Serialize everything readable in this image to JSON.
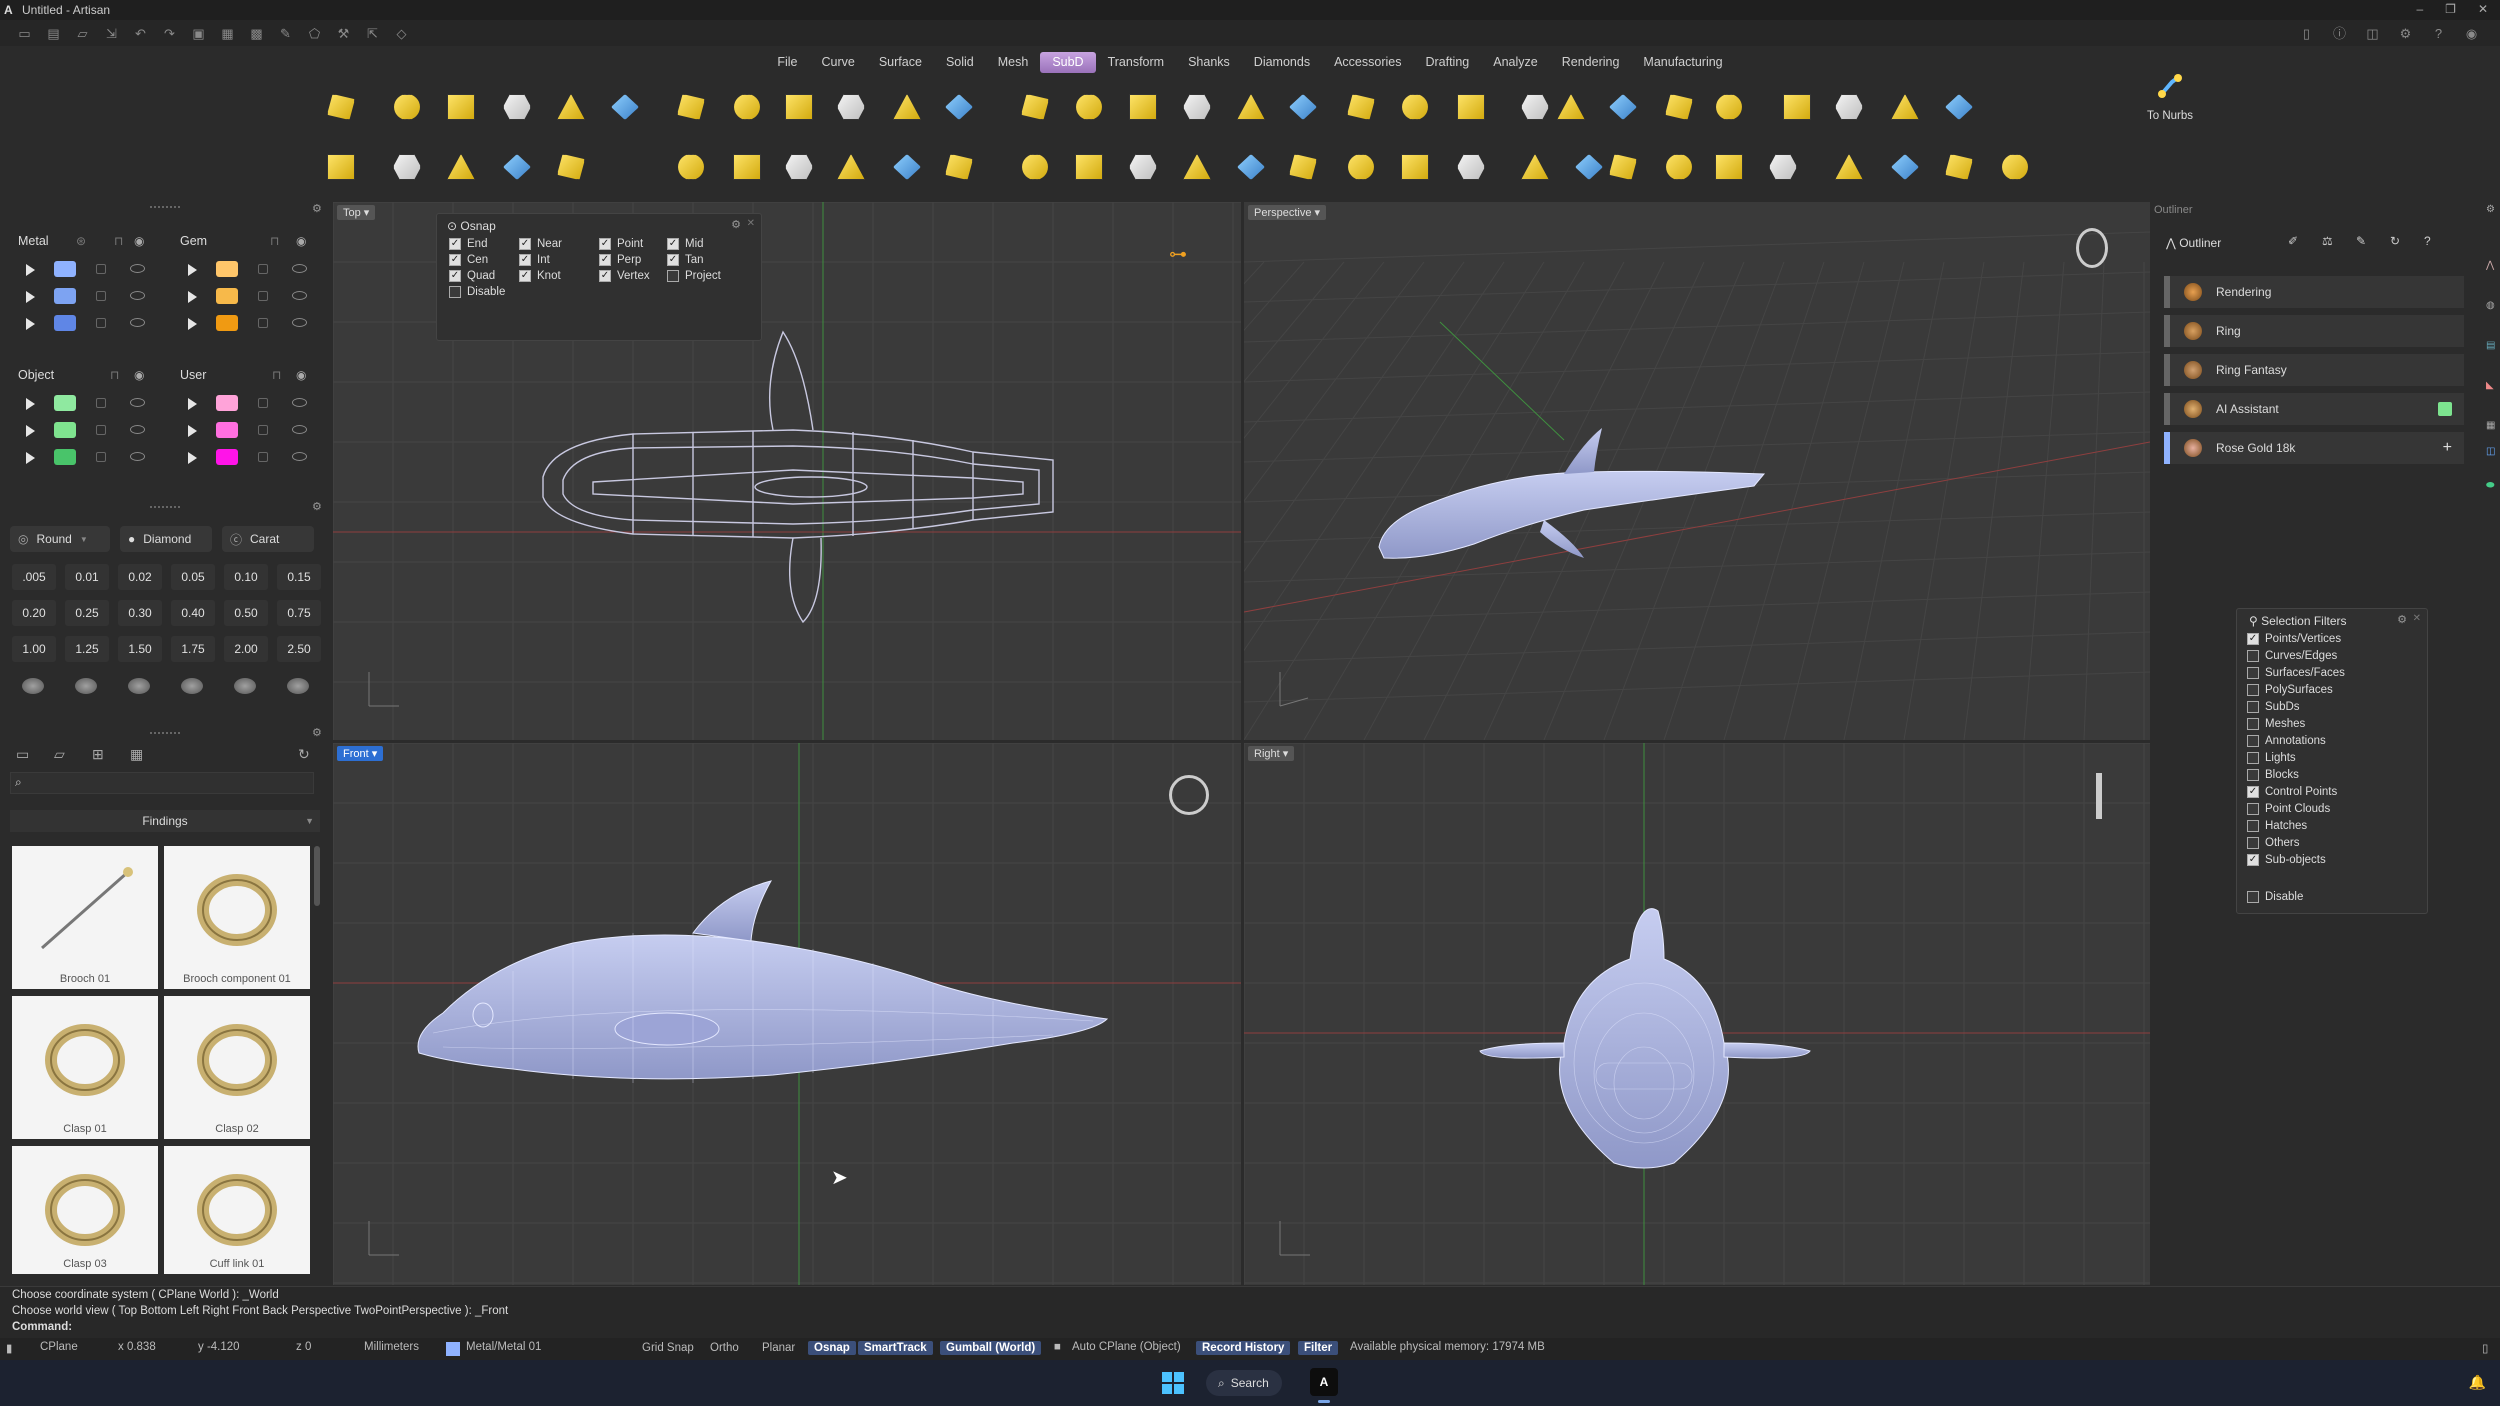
{
  "window": {
    "title": "Untitled - Artisan",
    "logo": "A"
  },
  "menu": [
    "File",
    "Curve",
    "Surface",
    "Solid",
    "Mesh",
    "SubD",
    "Transform",
    "Shanks",
    "Diamonds",
    "Accessories",
    "Drafting",
    "Analyze",
    "Rendering",
    "Manufacturing"
  ],
  "menu_active": "SubD",
  "toolbar": {
    "to_nurbs_label": "To Nurbs"
  },
  "materials": {
    "metal": {
      "label": "Metal",
      "swatches": [
        "#8fb2ff",
        "#7da3f2",
        "#5f86e6"
      ]
    },
    "gem": {
      "label": "Gem",
      "swatches": [
        "#ffc66a",
        "#f7b94a",
        "#f09a12"
      ]
    },
    "object": {
      "label": "Object",
      "swatches": [
        "#8fe9a0",
        "#7fe38f",
        "#49c46a"
      ]
    },
    "user": {
      "label": "User",
      "swatches": [
        "#ffa3d9",
        "#ff6fe0",
        "#ff14e8"
      ]
    }
  },
  "stone": {
    "shape_label": "Round",
    "cut_label": "Diamond",
    "unit_label": "Carat",
    "sizes": [
      ".005",
      "0.01",
      "0.02",
      "0.05",
      "0.10",
      "0.15",
      "0.20",
      "0.25",
      "0.30",
      "0.40",
      "0.50",
      "0.75",
      "1.00",
      "1.25",
      "1.50",
      "1.75",
      "2.00",
      "2.50"
    ]
  },
  "library": {
    "category": "Findings",
    "search_placeholder": "",
    "items": [
      "Brooch 01",
      "Brooch component 01",
      "Clasp 01",
      "Clasp 02",
      "Clasp 03",
      "Cuff link 01"
    ]
  },
  "viewports": {
    "top": "Top",
    "perspective": "Perspective",
    "front": "Front",
    "right": "Right"
  },
  "osnap": {
    "title": "Osnap",
    "options": [
      {
        "label": "End",
        "checked": true
      },
      {
        "label": "Near",
        "checked": true
      },
      {
        "label": "Point",
        "checked": true
      },
      {
        "label": "Mid",
        "checked": true
      },
      {
        "label": "Cen",
        "checked": true
      },
      {
        "label": "Int",
        "checked": true
      },
      {
        "label": "Perp",
        "checked": true
      },
      {
        "label": "Tan",
        "checked": true
      },
      {
        "label": "Quad",
        "checked": true
      },
      {
        "label": "Knot",
        "checked": true
      },
      {
        "label": "Vertex",
        "checked": true
      },
      {
        "label": "Project",
        "checked": false
      },
      {
        "label": "Disable",
        "checked": false
      }
    ]
  },
  "outliner": {
    "panel_title": "Outliner",
    "tab_label": "Outliner",
    "items": [
      "Rendering",
      "Ring",
      "Ring Fantasy",
      "AI Assistant",
      "Rose Gold 18k"
    ]
  },
  "selection_filters": {
    "title": "Selection Filters",
    "items": [
      {
        "label": "Points/Vertices",
        "checked": true
      },
      {
        "label": "Curves/Edges",
        "checked": false
      },
      {
        "label": "Surfaces/Faces",
        "checked": false
      },
      {
        "label": "PolySurfaces",
        "checked": false
      },
      {
        "label": "SubDs",
        "checked": false
      },
      {
        "label": "Meshes",
        "checked": false
      },
      {
        "label": "Annotations",
        "checked": false
      },
      {
        "label": "Lights",
        "checked": false
      },
      {
        "label": "Blocks",
        "checked": false
      },
      {
        "label": "Control Points",
        "checked": true
      },
      {
        "label": "Point Clouds",
        "checked": false
      },
      {
        "label": "Hatches",
        "checked": false
      },
      {
        "label": "Others",
        "checked": false
      },
      {
        "label": "Sub-objects",
        "checked": true
      }
    ],
    "disable_label": "Disable"
  },
  "command": {
    "history": [
      "Choose coordinate system ( CPlane  World ): _World",
      "Choose world view ( Top  Bottom  Left  Right  Front  Back  Perspective  TwoPointPerspective ): _Front"
    ],
    "prompt": "Command:"
  },
  "status": {
    "cplane": "CPlane",
    "x": "x 0.838",
    "y": "y -4.120",
    "z": "z 0",
    "units": "Millimeters",
    "layer": "Metal/Metal 01",
    "grid_snap": "Grid Snap",
    "ortho": "Ortho",
    "planar": "Planar",
    "osnap": "Osnap",
    "smarttrack": "SmartTrack",
    "gumball": "Gumball (World)",
    "auto_cplane": "Auto CPlane (Object)",
    "record_history": "Record History",
    "filter": "Filter",
    "memory": "Available physical memory: 17974 MB"
  },
  "taskbar": {
    "search_label": "Search",
    "app_letter": "A"
  }
}
